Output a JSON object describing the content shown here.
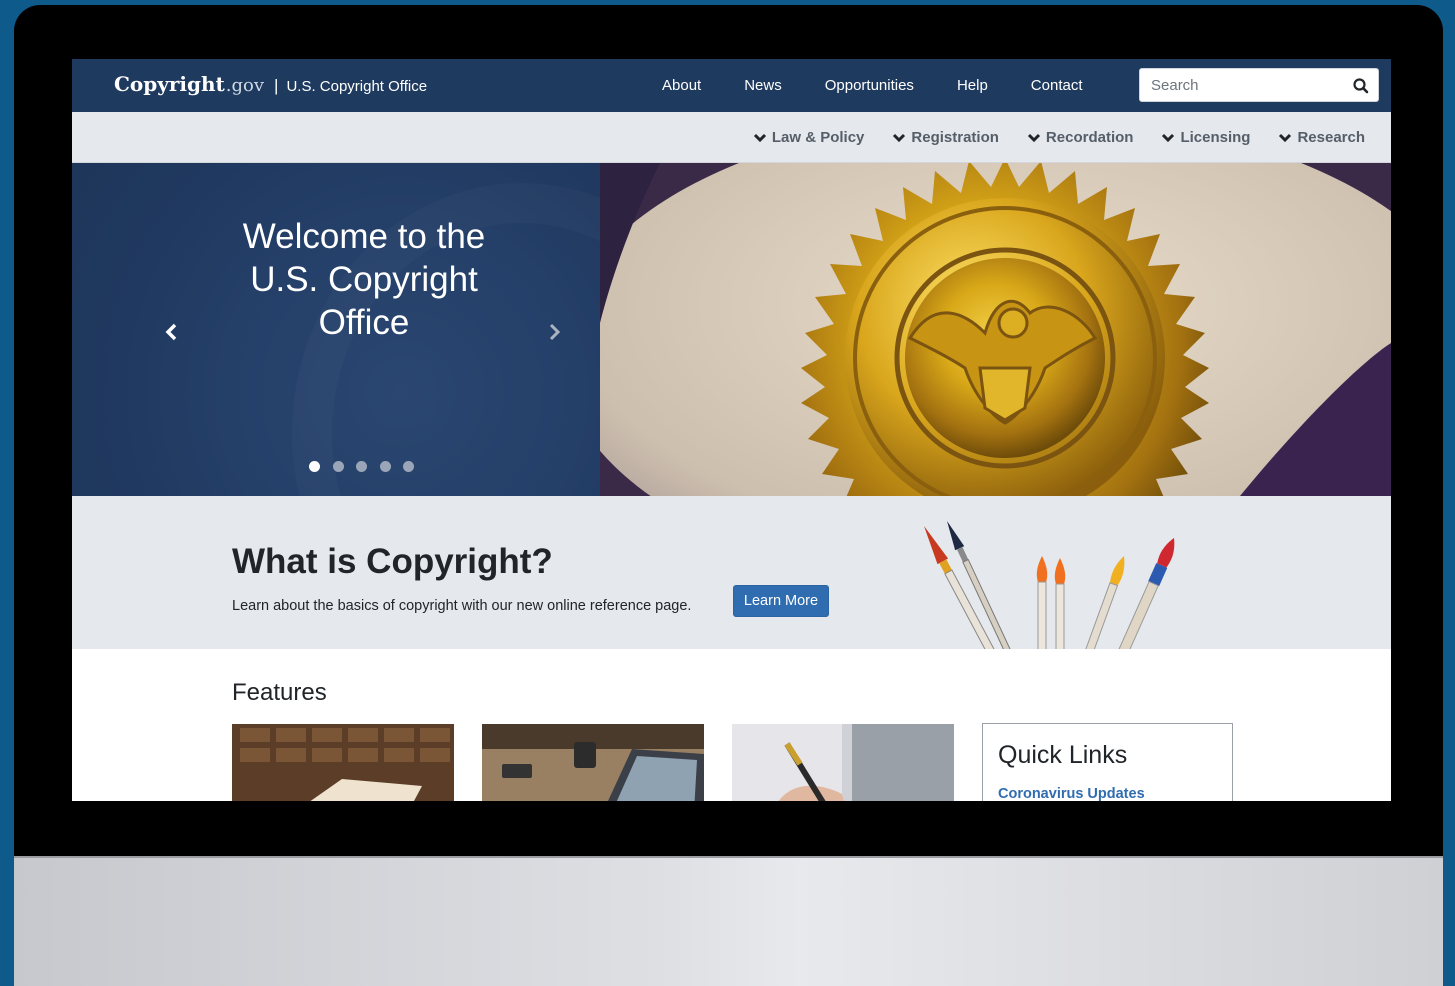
{
  "header": {
    "logo_text": "Copyright",
    "logo_tld": ".gov",
    "separator": "|",
    "office_name": "U.S. Copyright Office",
    "nav": [
      "About",
      "News",
      "Opportunities",
      "Help",
      "Contact"
    ],
    "search": {
      "placeholder": "Search",
      "value": ""
    }
  },
  "subnav": {
    "items": [
      "Law & Policy",
      "Registration",
      "Recordation",
      "Licensing",
      "Research"
    ]
  },
  "hero": {
    "title": "Welcome to the U.S. Copyright Office",
    "slide_count": 5,
    "active_slide": 1
  },
  "band": {
    "title": "What is Copyright?",
    "text": "Learn about the basics of copyright with our new online reference page.",
    "button": "Learn More"
  },
  "features": {
    "title": "Features"
  },
  "quick_links": {
    "title": "Quick Links",
    "first_link": "Coronavirus Updates"
  },
  "colors": {
    "navbar": "#1f3a5f",
    "subnav": "#e5e8ec",
    "accent": "#2f6db0",
    "background": "#0e5a8a"
  }
}
